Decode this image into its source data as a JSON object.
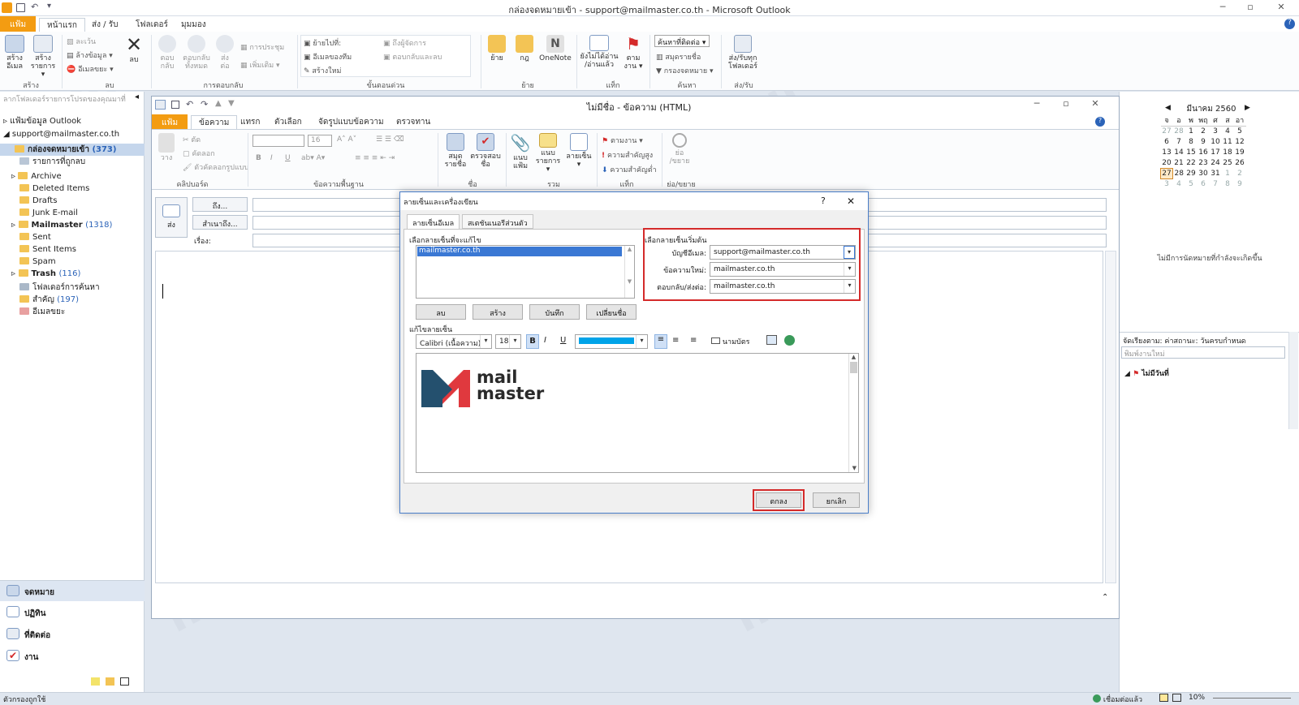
{
  "window": {
    "title": "กล่องจดหมายเข้า - support@mailmaster.co.th - Microsoft Outlook"
  },
  "tabs": [
    "แฟ้ม",
    "หน้าแรก",
    "ส่ง / รับ",
    "โฟลเดอร์",
    "มุมมอง"
  ],
  "ribbon": {
    "new_email": "สร้าง\nอีเมล",
    "new_items": "สร้าง\nรายการ ▾",
    "ignore": "ละเว้น",
    "cleanup": "ล้างข้อมูล ▾",
    "junk": "อีเมลขยะ ▾",
    "delete": "ลบ",
    "reply": "ตอบ\nกลับ",
    "reply_all": "ตอบกลับ\nทั้งหมด",
    "forward": "ส่ง\nต่อ",
    "meeting": "การประชุม",
    "more": "เพิ่มเติม ▾",
    "qs_move": "ย้ายไปที่:",
    "qs_team": "อีเมลของทีม",
    "qs_new": "สร้างใหม่",
    "qs_manager": "ถึงผู้จัดการ",
    "qs_done": "ตอบกลับและลบ",
    "move": "ย้าย",
    "rules": "กฎ",
    "onenote": "OneNote",
    "unread": "ยังไม่ได้อ่าน\n/อ่านแล้ว",
    "followup": "ตาม\nงาน ▾",
    "find_contact": "ค้นหาที่ติดต่อ ▾",
    "address_book": "สมุดรายชื่อ",
    "filter": "กรองจดหมาย ▾",
    "send_receive": "ส่ง/รับทุก\nโฟลเดอร์",
    "groups": [
      "สร้าง",
      "ลบ",
      "การตอบกลับ",
      "ขั้นตอนด่วน",
      "ย้าย",
      "แท็ก",
      "ค้นหา",
      "ส่ง/รับ"
    ]
  },
  "nav": {
    "hint": "ลากโฟลเดอร์รายการโปรดของคุณมาที่",
    "outlook_data": "แฟ้มข้อมูล Outlook",
    "account": "support@mailmaster.co.th",
    "folders": [
      {
        "name": "กล่องจดหมายเข้า",
        "count": "(373)"
      },
      {
        "name": "รายการที่ถูกลบ",
        "count": ""
      },
      {
        "name": "Archive",
        "count": ""
      },
      {
        "name": "Deleted Items",
        "count": ""
      },
      {
        "name": "Drafts",
        "count": ""
      },
      {
        "name": "Junk E-mail",
        "count": ""
      },
      {
        "name": "Mailmaster",
        "count": "(1318)"
      },
      {
        "name": "Sent",
        "count": ""
      },
      {
        "name": "Sent Items",
        "count": ""
      },
      {
        "name": "Spam",
        "count": ""
      },
      {
        "name": "Trash",
        "count": "(116)"
      },
      {
        "name": "โฟลเดอร์การค้นหา",
        "count": ""
      },
      {
        "name": "สำคัญ",
        "count": "(197)"
      },
      {
        "name": "อีเมลขยะ",
        "count": ""
      }
    ],
    "buttons": [
      "จดหมาย",
      "ปฏิทิน",
      "ที่ติดต่อ",
      "งาน"
    ]
  },
  "compose": {
    "title": "ไม่มีชื่อ - ข้อความ (HTML)",
    "tabs": [
      "แฟ้ม",
      "ข้อความ",
      "แทรก",
      "ตัวเลือก",
      "จัดรูปแบบข้อความ",
      "ตรวจทาน"
    ],
    "paste": "วาง",
    "cut": "ตัด",
    "copy": "คัดลอก",
    "format_painter": "ตัวคัดลอกรูปแบบ",
    "font_name": "",
    "font_size": "16",
    "address_book": "สมุด\nรายชื่อ",
    "check_names": "ตรวจสอบ\nชื่อ",
    "attach_file": "แนบ\nแฟ้ม",
    "attach_item": "แนบ\nรายการ ▾",
    "signature": "ลายเซ็น\n▾",
    "follow_up": "ตามงาน ▾",
    "high_importance": "ความสำคัญสูง",
    "low_importance": "ความสำคัญต่ำ",
    "zoom": "ย่อ\n/ขยาย",
    "groups": [
      "คลิปบอร์ด",
      "ข้อความพื้นฐาน",
      "ชื่อ",
      "รวม",
      "แท็ก",
      "ย่อ/ขยาย"
    ],
    "to": "ถึง...",
    "cc": "สำเนาถึง...",
    "subject": "เรื่อง:",
    "send": "ส่ง"
  },
  "dialog": {
    "title": "ลายเซ็นและเครื่องเขียน",
    "help": "?",
    "close": "✕",
    "tabs": [
      "ลายเซ็นอีเมล",
      "สเตชันเนอรีส่วนตัว"
    ],
    "select_label": "เลือกลายเซ็นที่จะแก้ไข",
    "signatures": [
      "mailmaster.co.th"
    ],
    "btn_delete": "ลบ",
    "btn_new": "สร้าง",
    "btn_save": "บันทึก",
    "btn_rename": "เปลี่ยนชื่อ",
    "default_label": "เลือกลายเซ็นเริ่มต้น",
    "account_label": "บัญชีอีเมล:",
    "account_value": "support@mailmaster.co.th",
    "new_msg_label": "ข้อความใหม่:",
    "new_msg_value": "mailmaster.co.th",
    "reply_label": "ตอบกลับ/ส่งต่อ:",
    "reply_value": "mailmaster.co.th",
    "edit_label": "แก้ไขลายเซ็น",
    "editor_font": "Calibri (เนื้อความ)",
    "editor_size": "18",
    "business_card": "นามบัตร",
    "logo_text1": "mail",
    "logo_text2": "master",
    "ok": "ตกลง",
    "cancel": "ยกเลิก"
  },
  "calendar": {
    "month": "มีนาคม 2560",
    "weekdays": [
      "จ",
      "อ",
      "พ",
      "พฤ",
      "ศ",
      "ส",
      "อา"
    ],
    "weeks": [
      [
        "27",
        "28",
        "1",
        "2",
        "3",
        "4",
        "5"
      ],
      [
        "6",
        "7",
        "8",
        "9",
        "10",
        "11",
        "12"
      ],
      [
        "13",
        "14",
        "15",
        "16",
        "17",
        "18",
        "19"
      ],
      [
        "20",
        "21",
        "22",
        "23",
        "24",
        "25",
        "26"
      ],
      [
        "27",
        "28",
        "29",
        "30",
        "31",
        "1",
        "2"
      ],
      [
        "3",
        "4",
        "5",
        "6",
        "7",
        "8",
        "9"
      ]
    ],
    "no_appointments": "ไม่มีการนัดหมายที่กำลังจะเกิดขึ้น",
    "arrange": "จัดเรียงตาม: ค่าสถานะ: วันครบกำหนด",
    "new_task": "พิมพ์งานใหม่",
    "no_date": "ไม่มีวันที่"
  },
  "status": {
    "left": "ตัวกรองถูกใช้",
    "connected": "เชื่อมต่อแล้ว",
    "zoom": "10%"
  },
  "colors": {
    "accent": "#f39c12",
    "red": "#d42a2a",
    "select": "#3a78d4",
    "logo_dark": "#24506e",
    "logo_red": "#e0393e"
  }
}
